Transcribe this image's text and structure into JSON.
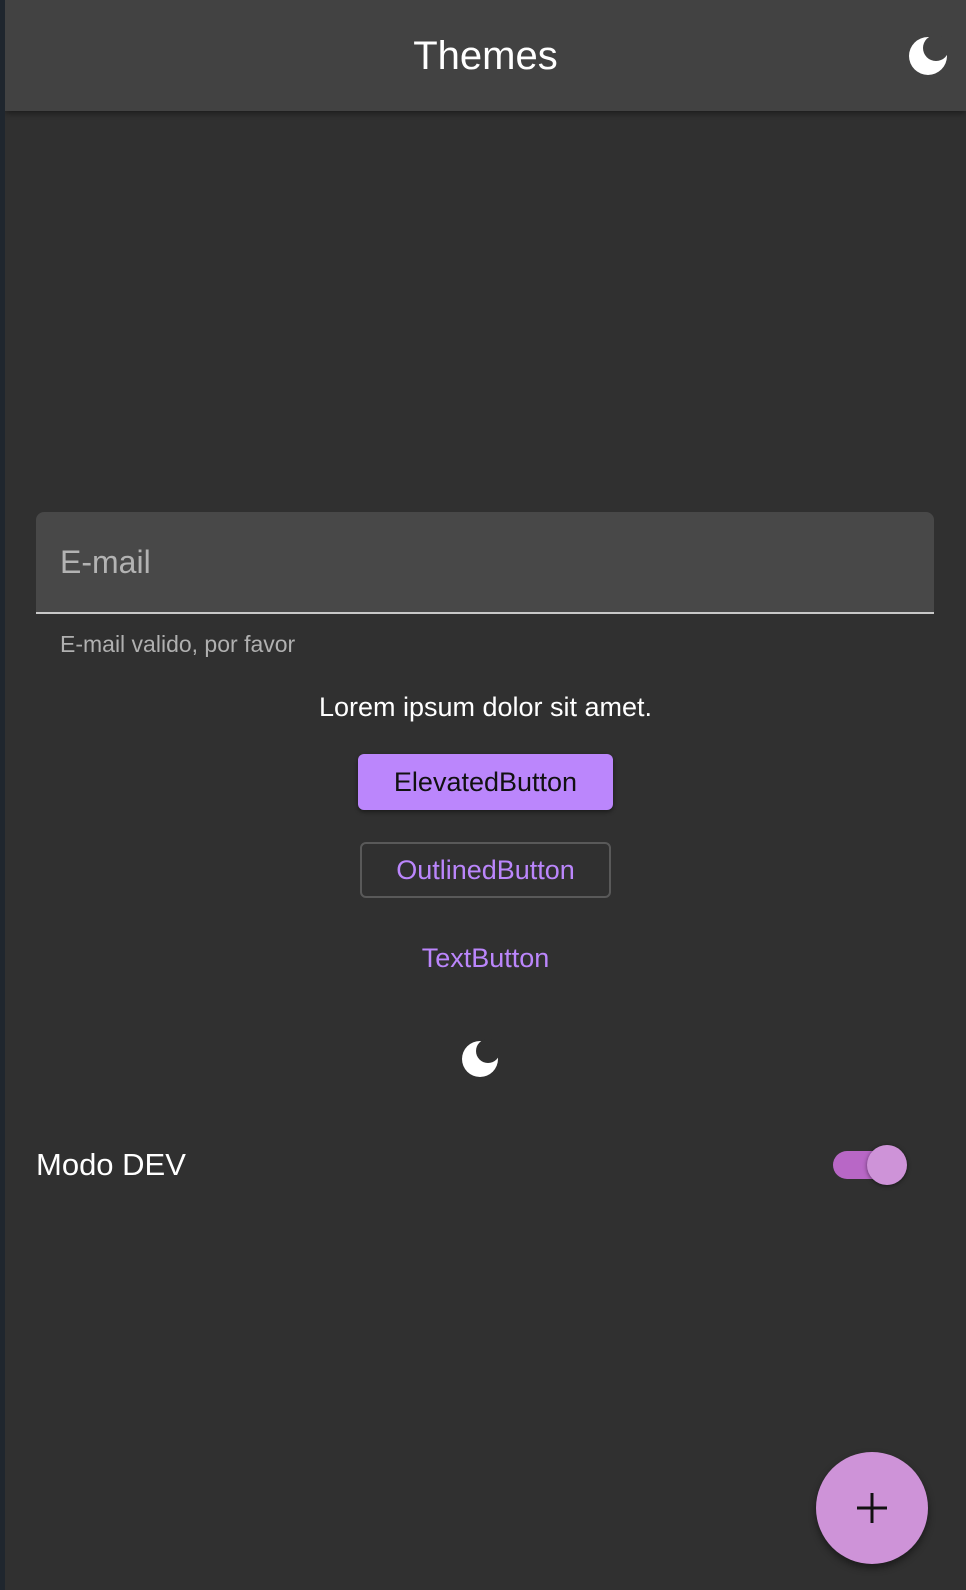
{
  "app_bar": {
    "title": "Themes",
    "action_icon": "dark-mode-icon"
  },
  "email_field": {
    "placeholder": "E-mail",
    "value": "",
    "helper_text": "E-mail valido, por favor"
  },
  "body_text": "Lorem ipsum dolor sit amet.",
  "buttons": {
    "elevated_label": "ElevatedButton",
    "outlined_label": "OutlinedButton",
    "text_label": "TextButton"
  },
  "center_icon": "dark-mode-icon",
  "dev_mode": {
    "label": "Modo DEV",
    "enabled": true
  },
  "fab": {
    "icon": "add-icon"
  },
  "colors": {
    "background": "#303030",
    "app_bar": "#424242",
    "primary": "#bb86fc",
    "accent": "#ce93d8"
  }
}
